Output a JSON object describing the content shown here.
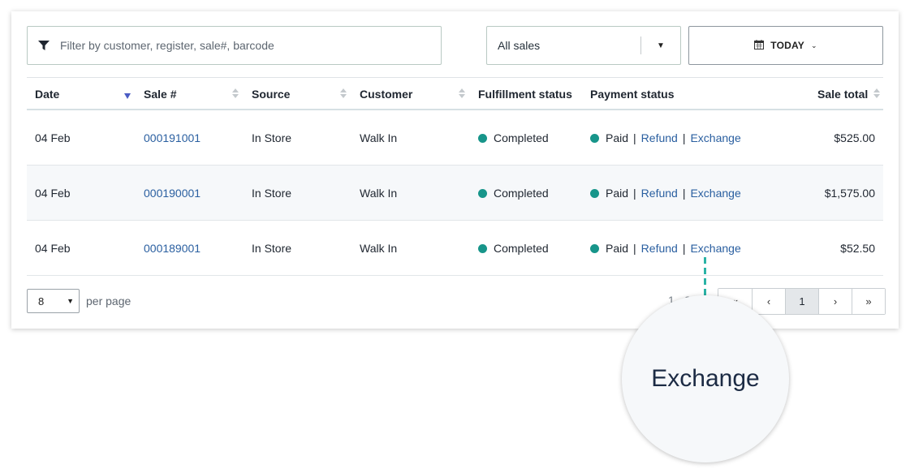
{
  "toolbar": {
    "filter_placeholder": "Filter by customer, register, sale#, barcode",
    "sales_select_value": "All sales",
    "date_button_label": "TODAY"
  },
  "table": {
    "columns": {
      "date": "Date",
      "sale": "Sale #",
      "source": "Source",
      "customer": "Customer",
      "fulfillment": "Fulfillment status",
      "payment": "Payment status",
      "total": "Sale total"
    },
    "rows": [
      {
        "date": "04 Feb",
        "sale": "000191001",
        "source": "In Store",
        "customer": "Walk In",
        "fulfillment": "Completed",
        "payment": "Paid",
        "refund": "Refund",
        "exchange": "Exchange",
        "total": "$525.00"
      },
      {
        "date": "04 Feb",
        "sale": "000190001",
        "source": "In Store",
        "customer": "Walk In",
        "fulfillment": "Completed",
        "payment": "Paid",
        "refund": "Refund",
        "exchange": "Exchange",
        "total": "$1,575.00"
      },
      {
        "date": "04 Feb",
        "sale": "000189001",
        "source": "In Store",
        "customer": "Walk In",
        "fulfillment": "Completed",
        "payment": "Paid",
        "refund": "Refund",
        "exchange": "Exchange",
        "total": "$52.50"
      }
    ]
  },
  "footer": {
    "per_page_value": "8",
    "per_page_label": "per page",
    "range_text": "1 - 3 of 3",
    "pages": {
      "first": "«",
      "prev": "‹",
      "current": "1",
      "next": "›",
      "last": "»"
    }
  },
  "callout": {
    "text": "Exchange"
  },
  "colors": {
    "status_dot": "#17958a",
    "link": "#2a5fa0",
    "active_sort": "#4b5cc4",
    "leader": "#2ab3a6"
  },
  "icons": {
    "filter": "filter-icon",
    "calendar": "calendar-icon"
  }
}
